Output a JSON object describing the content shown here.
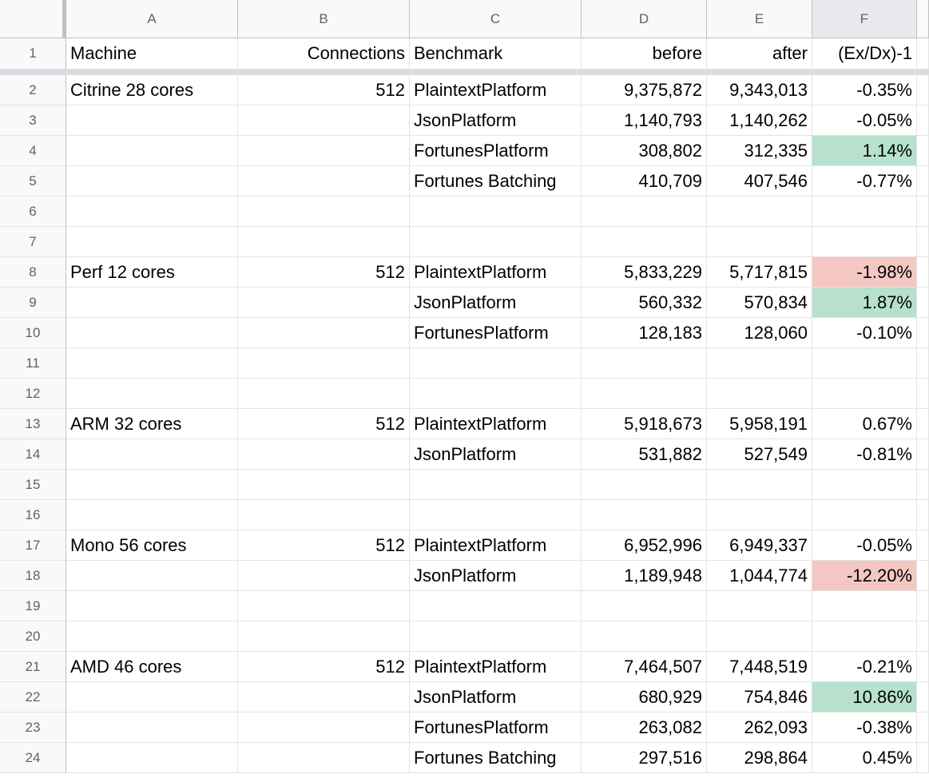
{
  "columns": [
    "A",
    "B",
    "C",
    "D",
    "E",
    "F"
  ],
  "selected_column": "F",
  "colors": {
    "green": "#b7e1cd",
    "red": "#f4c7c3"
  },
  "rows": [
    {
      "n": "1",
      "cells": [
        "Machine",
        "Connections",
        "Benchmark",
        "before",
        "after",
        "(Ex/Dx)-1"
      ],
      "fill": ""
    },
    {
      "n": "2",
      "cells": [
        "Citrine 28 cores",
        "512",
        "PlaintextPlatform",
        "9,375,872",
        "9,343,013",
        "-0.35%"
      ],
      "fill": ""
    },
    {
      "n": "3",
      "cells": [
        "",
        "",
        "JsonPlatform",
        "1,140,793",
        "1,140,262",
        "-0.05%"
      ],
      "fill": ""
    },
    {
      "n": "4",
      "cells": [
        "",
        "",
        "FortunesPlatform",
        "308,802",
        "312,335",
        "1.14%"
      ],
      "fill": "green"
    },
    {
      "n": "5",
      "cells": [
        "",
        "",
        "Fortunes Batching",
        "410,709",
        "407,546",
        "-0.77%"
      ],
      "fill": ""
    },
    {
      "n": "6",
      "cells": [
        "",
        "",
        "",
        "",
        "",
        ""
      ],
      "fill": ""
    },
    {
      "n": "7",
      "cells": [
        "",
        "",
        "",
        "",
        "",
        ""
      ],
      "fill": ""
    },
    {
      "n": "8",
      "cells": [
        "Perf 12 cores",
        "512",
        "PlaintextPlatform",
        "5,833,229",
        "5,717,815",
        "-1.98%"
      ],
      "fill": "red"
    },
    {
      "n": "9",
      "cells": [
        "",
        "",
        "JsonPlatform",
        "560,332",
        "570,834",
        "1.87%"
      ],
      "fill": "green"
    },
    {
      "n": "10",
      "cells": [
        "",
        "",
        "FortunesPlatform",
        "128,183",
        "128,060",
        "-0.10%"
      ],
      "fill": ""
    },
    {
      "n": "11",
      "cells": [
        "",
        "",
        "",
        "",
        "",
        ""
      ],
      "fill": ""
    },
    {
      "n": "12",
      "cells": [
        "",
        "",
        "",
        "",
        "",
        ""
      ],
      "fill": ""
    },
    {
      "n": "13",
      "cells": [
        "ARM 32 cores",
        "512",
        "PlaintextPlatform",
        "5,918,673",
        "5,958,191",
        "0.67%"
      ],
      "fill": ""
    },
    {
      "n": "14",
      "cells": [
        "",
        "",
        "JsonPlatform",
        "531,882",
        "527,549",
        "-0.81%"
      ],
      "fill": ""
    },
    {
      "n": "15",
      "cells": [
        "",
        "",
        "",
        "",
        "",
        ""
      ],
      "fill": ""
    },
    {
      "n": "16",
      "cells": [
        "",
        "",
        "",
        "",
        "",
        ""
      ],
      "fill": ""
    },
    {
      "n": "17",
      "cells": [
        "Mono 56 cores",
        "512",
        "PlaintextPlatform",
        "6,952,996",
        "6,949,337",
        "-0.05%"
      ],
      "fill": ""
    },
    {
      "n": "18",
      "cells": [
        "",
        "",
        "JsonPlatform",
        "1,189,948",
        "1,044,774",
        "-12.20%"
      ],
      "fill": "red"
    },
    {
      "n": "19",
      "cells": [
        "",
        "",
        "",
        "",
        "",
        ""
      ],
      "fill": ""
    },
    {
      "n": "20",
      "cells": [
        "",
        "",
        "",
        "",
        "",
        ""
      ],
      "fill": ""
    },
    {
      "n": "21",
      "cells": [
        "AMD 46 cores",
        "512",
        "PlaintextPlatform",
        "7,464,507",
        "7,448,519",
        "-0.21%"
      ],
      "fill": ""
    },
    {
      "n": "22",
      "cells": [
        "",
        "",
        "JsonPlatform",
        "680,929",
        "754,846",
        "10.86%"
      ],
      "fill": "green"
    },
    {
      "n": "23",
      "cells": [
        "",
        "",
        "FortunesPlatform",
        "263,082",
        "262,093",
        "-0.38%"
      ],
      "fill": ""
    },
    {
      "n": "24",
      "cells": [
        "",
        "",
        "Fortunes Batching",
        "297,516",
        "298,864",
        "0.45%"
      ],
      "fill": ""
    }
  ]
}
